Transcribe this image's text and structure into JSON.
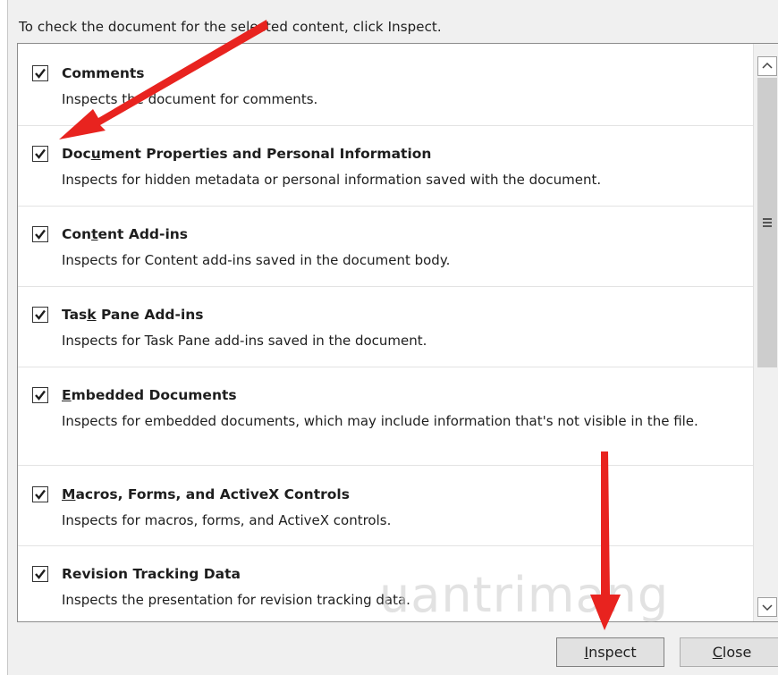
{
  "instruction": "To check the document for the selected content, click Inspect.",
  "items": [
    {
      "title_pre": "Comments",
      "title_ul": "",
      "title_post": "",
      "description": "Inspects the document for comments.",
      "checked": true
    },
    {
      "title_pre": "Doc",
      "title_ul": "u",
      "title_post": "ment Properties and Personal Information",
      "description": "Inspects for hidden metadata or personal information saved with the document.",
      "checked": true
    },
    {
      "title_pre": "Con",
      "title_ul": "t",
      "title_post": "ent Add-ins",
      "description": "Inspects for Content add-ins saved in the document body.",
      "checked": true
    },
    {
      "title_pre": "Tas",
      "title_ul": "k",
      "title_post": " Pane Add-ins",
      "description": "Inspects for Task Pane add-ins saved in the document.",
      "checked": true
    },
    {
      "title_pre": "",
      "title_ul": "E",
      "title_post": "mbedded Documents",
      "description": "Inspects for embedded documents, which may include information that's not visible in the file.",
      "checked": true
    },
    {
      "title_pre": "",
      "title_ul": "M",
      "title_post": "acros, Forms, and ActiveX Controls",
      "description": "Inspects for macros, forms, and ActiveX controls.",
      "checked": true
    },
    {
      "title_pre": "Revision Tracking Data",
      "title_ul": "",
      "title_post": "",
      "description": "Inspects the presentation for revision tracking data.",
      "checked": true
    }
  ],
  "buttons": {
    "inspect_ul": "I",
    "inspect_rest": "nspect",
    "close_ul": "C",
    "close_rest": "lose"
  },
  "watermark": "uantrimang",
  "colors": {
    "arrow": "#e8231f",
    "dialog_bg": "#f0f0f0"
  }
}
